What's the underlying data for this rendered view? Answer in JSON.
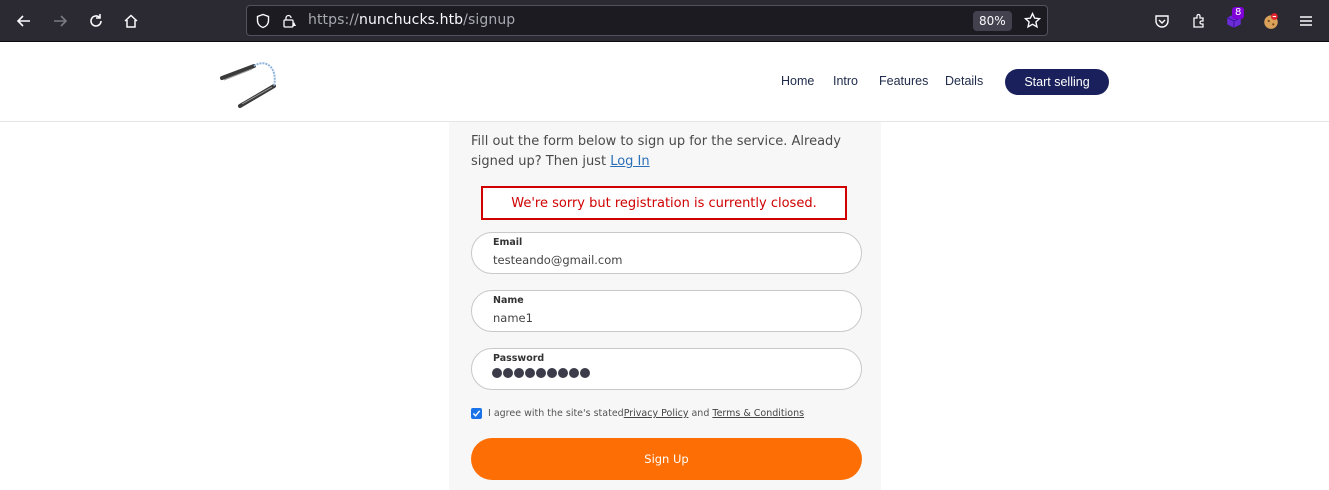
{
  "browser": {
    "url_prefix": "https://",
    "url_host": "nunchucks.htb",
    "url_path": "/signup",
    "zoom": "80%",
    "extension_badge": "8"
  },
  "nav": {
    "links": [
      "Home",
      "Intro",
      "Features",
      "Details"
    ],
    "cta": "Start selling"
  },
  "form": {
    "intro_text": "Fill out the form below to sign up for the service. Already signed up? Then just ",
    "login_link": "Log In",
    "error": "We're sorry but registration is currently closed.",
    "email_label": "Email",
    "email_value": "testeando@gmail.com",
    "name_label": "Name",
    "name_value": "name1",
    "password_label": "Password",
    "password_length": 9,
    "agree_prefix": "I agree with the site's stated ",
    "privacy_link": "Privacy Policy",
    "agree_and": " and ",
    "terms_link": "Terms & Conditions",
    "agree_checked": true,
    "submit_label": "Sign Up"
  },
  "colors": {
    "accent": "#fd6f05",
    "nav_cta": "#19205c",
    "error": "#d00000"
  }
}
